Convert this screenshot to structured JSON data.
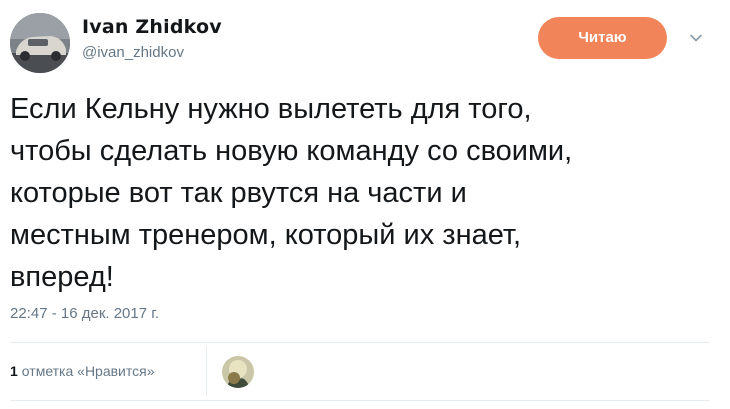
{
  "author": {
    "display_name": "Ivan Zhidkov",
    "handle": "@ivan_zhidkov",
    "avatar_icon": "car-photo-avatar"
  },
  "follow_button": {
    "label": "Читаю",
    "color": "#f2845a"
  },
  "menu_icon": "chevron-down-icon",
  "tweet": {
    "text": "Если Кельну нужно вылететь для того,\nчтобы сделать новую команду со своими,\nкоторые вот так рвутся на части и\nместным тренером, который их знает,\nвперед!",
    "timestamp": "22:47 - 16 дек. 2017 г."
  },
  "stats": {
    "likes_count": "1",
    "likes_label": "отметка «Нравится»"
  },
  "colors": {
    "text": "#14171a",
    "secondary": "#657786",
    "divider": "#e6ecf0"
  }
}
